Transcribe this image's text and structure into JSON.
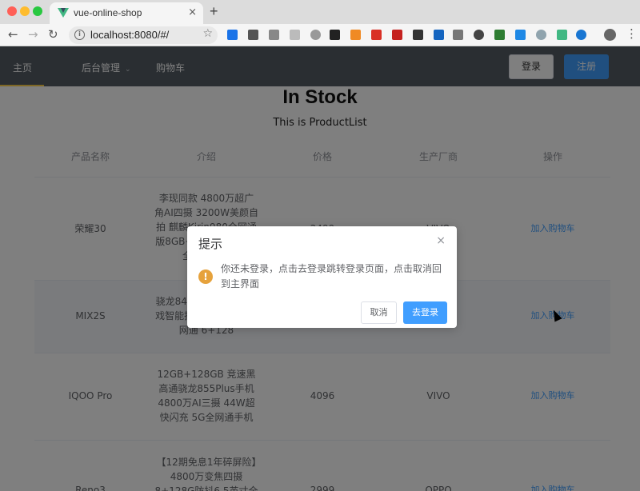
{
  "browser": {
    "tab_title": "vue-online-shop",
    "tab_close": "×",
    "new_tab": "+",
    "url": "localhost:8080/#/",
    "back": "←",
    "forward": "→",
    "reload": "↻",
    "star": "☆",
    "info": "i"
  },
  "header": {
    "nav": [
      {
        "label": "主页"
      },
      {
        "label": "后台管理",
        "caret": "⌄"
      },
      {
        "label": "购物车"
      }
    ],
    "login": "登录",
    "register": "注册",
    "colors": {
      "bg": "#545c64",
      "active": "#ffd04b",
      "primary": "#409eff"
    }
  },
  "page": {
    "title": "In Stock",
    "subtitle": "This is ProductList"
  },
  "table": {
    "headers": [
      "产品名称",
      "介绍",
      "价格",
      "生产厂商",
      "操作"
    ],
    "rows": [
      {
        "name": "荣耀30",
        "desc": "李现同款 4800万超广角AI四摄 3200W美颜自拍 麒麟Kirin980全网通版8GB+128GB 幻夜黑 全面屏手机",
        "price": "2499",
        "maker": "VIVO",
        "action": "加入购物车"
      },
      {
        "name": "MIX2S",
        "desc": "骁龙845 全面屏NFC 游戏智能拍照手机 白色 全网通 6+128",
        "price": "1688",
        "maker": "小米",
        "action": "加入购物车"
      },
      {
        "name": "IQOO Pro",
        "desc": "12GB+128GB 竞速黑 高通骁龙855Plus手机 4800万AI三摄 44W超快闪充 5G全网通手机",
        "price": "4096",
        "maker": "VIVO",
        "action": "加入购物车"
      },
      {
        "name": "Reno3",
        "desc": "【12期免息1年碎屏险】4800万变焦四摄8+128G防抖6.5英寸全面屏新 超薄",
        "price": "2999",
        "maker": "OPPO",
        "action": "加入购物车"
      }
    ]
  },
  "dialog": {
    "title": "提示",
    "close": "×",
    "warn_icon": "!",
    "message": "你还未登录，点击去登录跳转登录页面，点击取消回到主界面",
    "cancel": "取消",
    "confirm": "去登录"
  }
}
